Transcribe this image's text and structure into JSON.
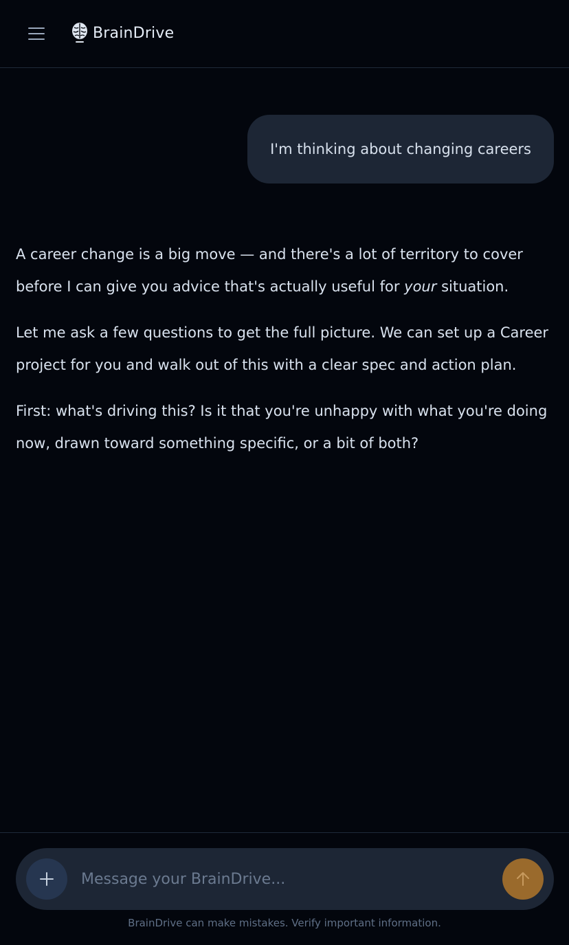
{
  "header": {
    "brand_name": "BrainDrive",
    "menu_icon": "hamburger-menu-icon",
    "logo_icon": "brain-icon"
  },
  "conversation": {
    "user_message": "I'm thinking about changing careers",
    "assistant_paragraphs": [
      {
        "before": "A career change is a big move — and there's a lot of territory to cover before I can give you advice that's actually useful for ",
        "emphasis": "your",
        "after": " situation."
      },
      {
        "text": "Let me ask a few questions to get the full picture. We can set up a Career project for you and walk out of this with a clear spec and action plan."
      },
      {
        "text": "First: what's driving this? Is it that you're unhappy with what you're doing now, drawn toward something specific, or a bit of both?"
      }
    ]
  },
  "composer": {
    "placeholder": "Message your BrainDrive...",
    "value": "",
    "attach_icon": "plus-icon",
    "send_icon": "arrow-up-icon"
  },
  "footer": {
    "disclaimer": "BrainDrive can make mistakes. Verify important information."
  },
  "colors": {
    "background": "#03060d",
    "bubble": "#1d2635",
    "send_button": "#9a6a2c",
    "attach_button": "#263650",
    "text": "#d9e2ee",
    "muted_text": "#5f6f86"
  }
}
